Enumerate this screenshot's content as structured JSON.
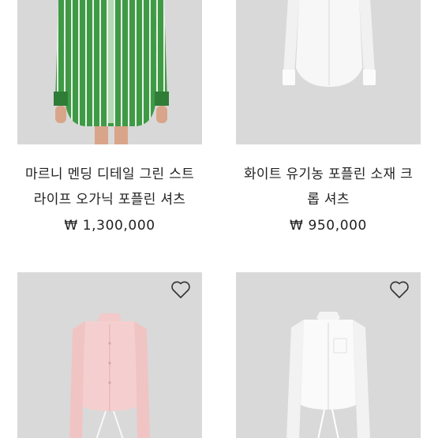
{
  "products": [
    {
      "name_line1": "마르니 멘딩 디테일 그린 스트",
      "name_line2": "라이프 오가닉 포플린 셔츠",
      "price": "₩ 1,300,000",
      "image": "green-striped-shirt"
    },
    {
      "name_line1": "화이트 유기농 포플린 소재 크",
      "name_line2": "롭 셔츠",
      "price": "₩ 950,000",
      "image": "white-cropped-shirt"
    },
    {
      "image": "pink-cropped-shirt",
      "wishlist_icon": "heart-outline-icon"
    },
    {
      "image": "white-drawstring-shirt",
      "wishlist_icon": "heart-outline-icon"
    }
  ]
}
